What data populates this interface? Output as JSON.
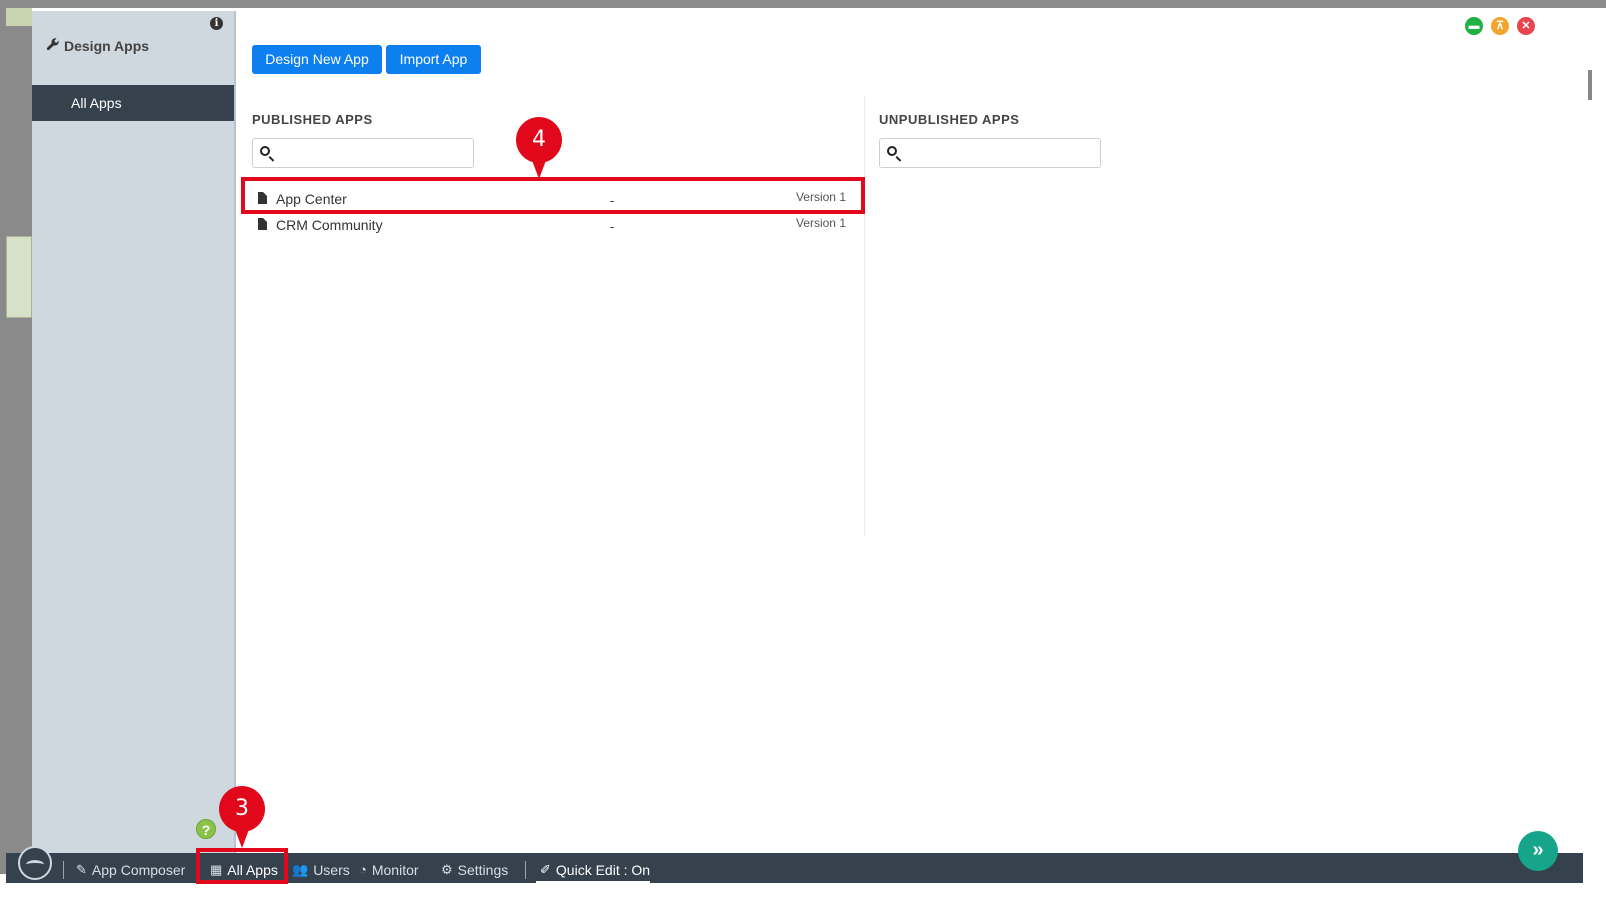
{
  "sidebar": {
    "title": "Design Apps",
    "info_icon": "info-icon",
    "active_item": "All Apps",
    "help_icon": "question-icon"
  },
  "toolbar": {
    "design_new_label": "Design New App",
    "import_label": "Import App"
  },
  "published": {
    "title": "PUBLISHED APPS",
    "search_value": "",
    "search_placeholder": "",
    "apps": [
      {
        "name": "App Center",
        "dash": "-",
        "version": "Version 1"
      },
      {
        "name": "CRM Community",
        "dash": "-",
        "version": "Version 1"
      }
    ]
  },
  "unpublished": {
    "title": "UNPUBLISHED APPS",
    "search_value": "",
    "search_placeholder": ""
  },
  "window_controls": {
    "minimize_color": "#1fb141",
    "pin_color": "#f0a52d",
    "close_color": "#e9454f"
  },
  "taskbar": {
    "app_composer": "App Composer",
    "all_apps": "All Apps",
    "users": "Users",
    "monitor": "Monitor",
    "settings": "Settings",
    "quick_edit": "Quick Edit : On"
  },
  "annotations": {
    "step3": "3",
    "step4": "4",
    "highlight_color": "#e0081a"
  }
}
